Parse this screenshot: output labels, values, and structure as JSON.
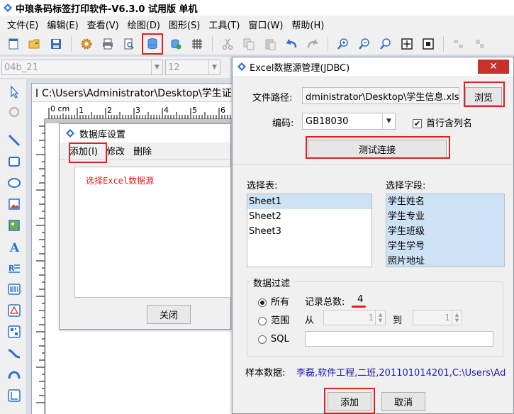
{
  "app": {
    "title": "中琅条码标签打印软件-V6.3.0 试用版 单机"
  },
  "menubar": {
    "items": [
      "文件(E)",
      "编辑(E)",
      "查看(V)",
      "绘图(D)",
      "图形(S)",
      "工具(T)",
      "窗口(W)",
      "帮助(H)"
    ]
  },
  "fontbar": {
    "font_value": "04b_21",
    "size_value": "12"
  },
  "document": {
    "title": "C:\\Users\\Administrator\\Desktop\\学生证.z",
    "ruler_label": "0 cm"
  },
  "db_dialog": {
    "title": "数据库设置",
    "menu_add": "添加(I)",
    "menu_edit": "修改",
    "menu_delete": "删除",
    "hint": "选择Excel数据源",
    "close_label": "关闭"
  },
  "excel_dialog": {
    "title": "Excel数据源管理(JDBC)",
    "close_glyph": "✕",
    "file_path_label": "文件路径:",
    "file_path_value": "dministrator\\Desktop\\学生信息.xlsx",
    "browse_label": "浏览",
    "encoding_label": "编码:",
    "encoding_value": "GB18030",
    "first_row_label": "首行含列名",
    "first_row_checked": true,
    "test_connection_label": "测试连接",
    "select_table_label": "选择表:",
    "tables": [
      "Sheet1",
      "Sheet2",
      "Sheet3"
    ],
    "select_field_label": "选择字段:",
    "fields": [
      "学生姓名",
      "学生专业",
      "学生班级",
      "学生学号",
      "照片地址"
    ],
    "filter_label": "数据过滤",
    "filter_all": "所有",
    "filter_range": "范围",
    "filter_sql": "SQL",
    "record_total_label": "记录总数:",
    "record_total_value": "4",
    "from_label": "从",
    "from_value": "1",
    "to_label": "到",
    "to_value": "1",
    "sample_label": "样本数据:",
    "sample_value": "李磊,软件工程,二班,201101014201,C:\\Users\\Ad",
    "add_label": "添加",
    "cancel_label": "取消"
  },
  "colors": {
    "highlight_red": "#e02020",
    "selection_blue": "#cde2f5",
    "sample_text": "#1a1ab8"
  }
}
